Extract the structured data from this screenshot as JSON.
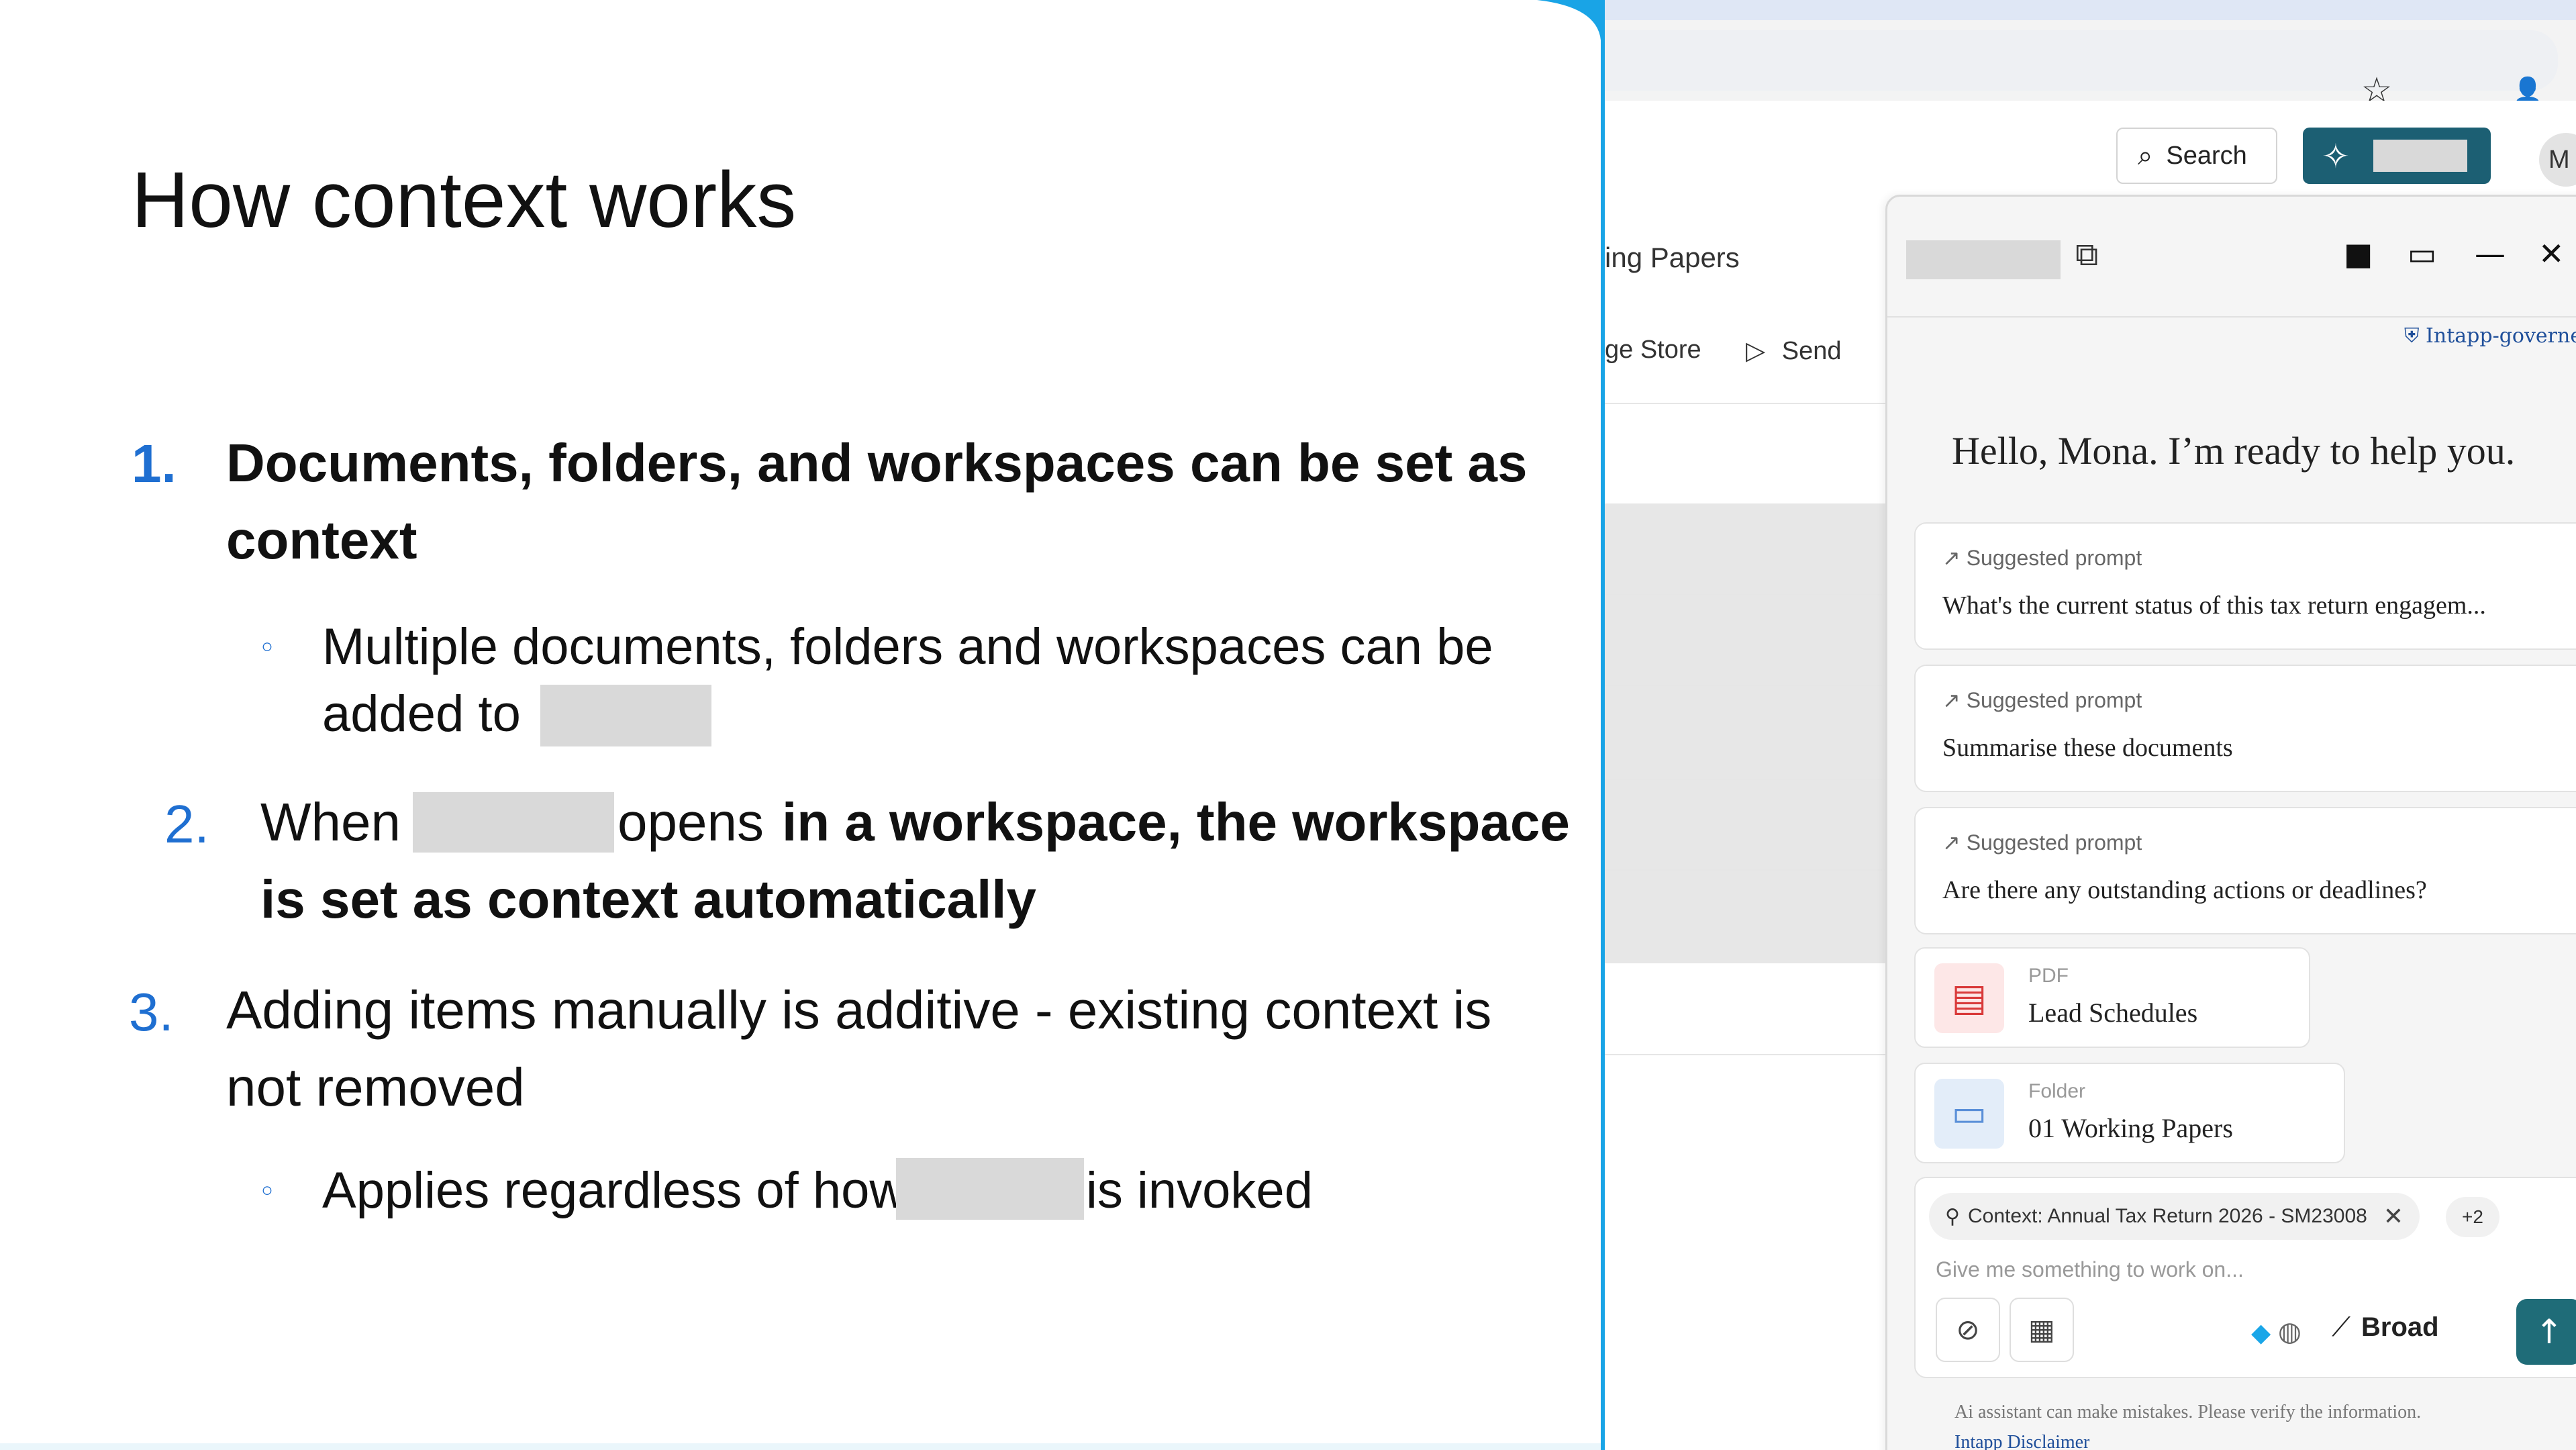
{
  "slide": {
    "title": "How context works",
    "item1": {
      "number": "1.",
      "line1": "Documents, folders, and workspaces can be set as",
      "line2": "context",
      "sub_line1": "Multiple documents, folders and workspaces can be",
      "sub_line2_prefix": "added to"
    },
    "item2": {
      "number": "2.",
      "prefix": "When",
      "middle": "opens",
      "bold1": "in a workspace, the workspace",
      "bold2": "is set as context automatically"
    },
    "item3": {
      "number": "3.",
      "line1": "Adding items manually is additive - existing context is",
      "line2": "not removed",
      "sub_prefix": "Applies regardless of how",
      "sub_suffix": "is invoked"
    },
    "bullet_glyph": "◦"
  },
  "browser": {
    "star_icon": "☆",
    "profile_icon": "👤"
  },
  "app": {
    "search_label": "Search",
    "search_icon": "⌕",
    "assistant_icon": "✧",
    "avatar_text": "M",
    "breadcrumb": "ing Papers",
    "toolbar_store": "ge Store",
    "toolbar_send": "Send",
    "send_icon": "▷"
  },
  "assistant": {
    "ext_icon": "⧉",
    "head_icons": [
      "■",
      "▭",
      "—",
      "✕"
    ],
    "governed": "Intapp-governed",
    "hello": "Hello, Mona. I’m ready to help you.",
    "prompts": [
      {
        "kicker": "Suggested prompt",
        "text": "What's the current status of this tax return engagem..."
      },
      {
        "kicker": "Suggested prompt",
        "text": "Summarise these documents"
      },
      {
        "kicker": "Suggested prompt",
        "text": "Are there any outstanding actions or deadlines?"
      }
    ],
    "kicker_icon": "↗",
    "files": [
      {
        "type": "PDF",
        "name": "Lead Schedules",
        "icon": "▤",
        "color": "#d93a3a",
        "bg": "#fde7e7"
      },
      {
        "type": "Folder",
        "name": "01 Working Papers",
        "icon": "▭",
        "color": "#5a8fd8",
        "bg": "#e3edf9"
      }
    ],
    "context_chip": "Context: Annual Tax Return 2026 - SM23008",
    "context_icon": "⚲",
    "context_close": "✕",
    "more_chip": "+2",
    "placeholder": "Give me something to work on...",
    "attach_icon": "⊘",
    "clipboard_icon": "▦",
    "model_dot": "◆",
    "globe_icon": "◍",
    "broad_icon": "⟋",
    "broad_label": "Broad",
    "send_icon": "↑",
    "disclaimer": "Ai assistant can make mistakes. Please verify the information.",
    "disclaimer_link": "Intapp Disclaimer"
  },
  "colors": {
    "accent_blue": "#1f6fd1",
    "divider": "#19a4e6",
    "brand_teal": "#1c5f73"
  }
}
